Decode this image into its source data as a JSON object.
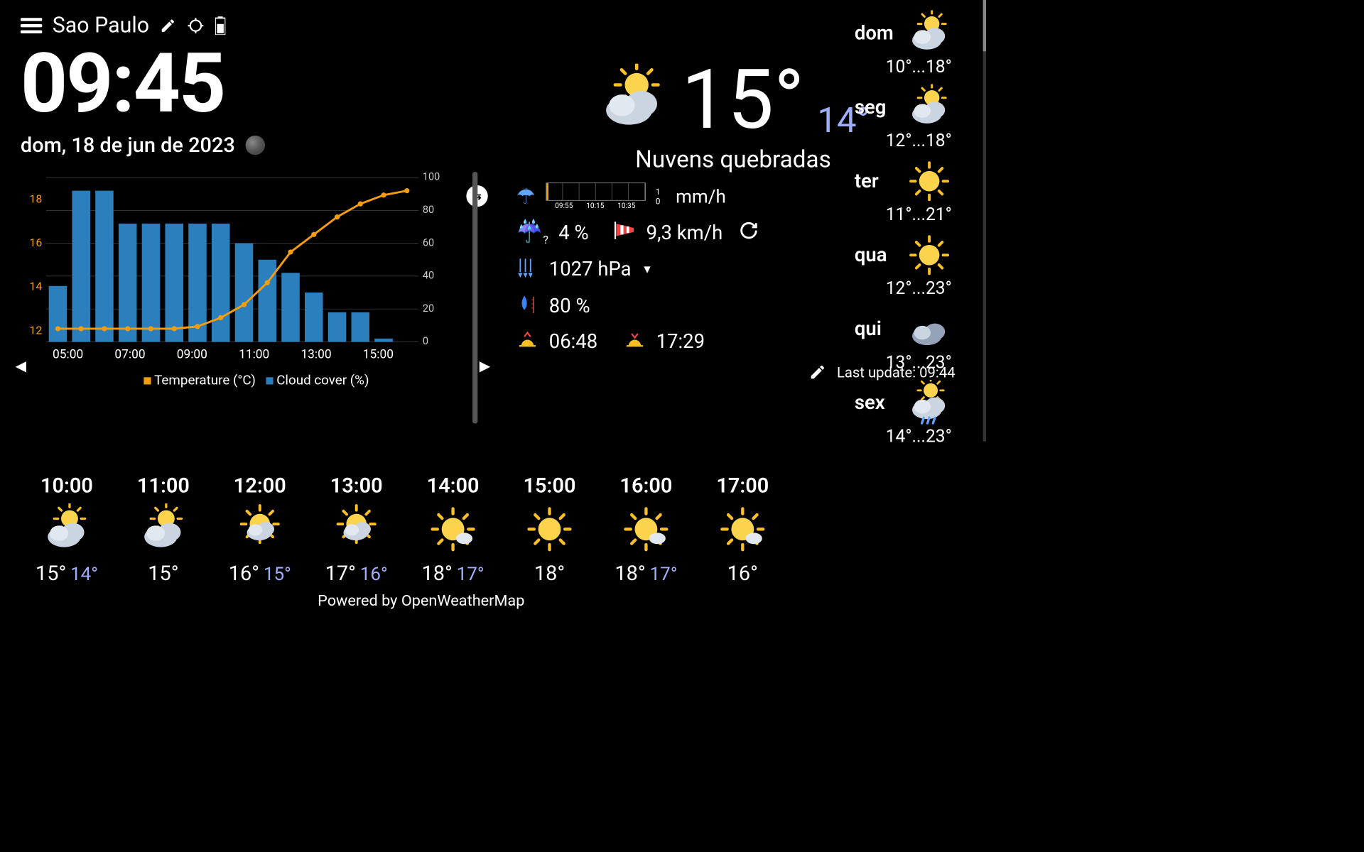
{
  "header": {
    "location": "Sao Paulo"
  },
  "clock": {
    "time": "09:45",
    "date": "dom, 18 de jun de 2023"
  },
  "chart_data": {
    "type": "bar",
    "title": "",
    "series": [
      {
        "name": "Temperature (°C)",
        "color": "#f59e0b",
        "axis": "left",
        "type": "line",
        "values": [
          12.1,
          12.1,
          12.1,
          12.1,
          12.1,
          12.1,
          12.2,
          12.6,
          13.2,
          14.2,
          15.6,
          16.4,
          17.2,
          17.8,
          18.2,
          18.4
        ]
      },
      {
        "name": "Cloud cover (%)",
        "color": "#2b7fbd",
        "axis": "right",
        "type": "bar",
        "values": [
          34,
          92,
          92,
          72,
          72,
          72,
          72,
          72,
          60,
          50,
          42,
          30,
          18,
          18,
          2,
          0
        ]
      }
    ],
    "x_ticks": [
      "05:00",
      "07:00",
      "09:00",
      "11:00",
      "13:00",
      "15:00"
    ],
    "left_axis": {
      "label": "Temperature (°C)",
      "ticks": [
        12,
        14,
        16,
        18
      ]
    },
    "right_axis": {
      "label": "Cloud cover (%)",
      "ticks": [
        0,
        20,
        40,
        60,
        80,
        100
      ]
    }
  },
  "current": {
    "temp": "15°",
    "feels": "14°",
    "condition": "Nuvens quebradas",
    "precip_unit": "mm/h",
    "precip_times": [
      "09:55",
      "10:15",
      "10:35"
    ],
    "precip_scale_max": "1",
    "precip_scale_min": "0",
    "pop": "4 %",
    "wind": "9,3 km/h",
    "pressure": "1027 hPa",
    "humidity": "80 %",
    "sunrise": "06:48",
    "sunset": "17:29",
    "last_update_label": "Last update:",
    "last_update": "09:44"
  },
  "hourly": [
    {
      "time": "10:00",
      "icon": "partly-cloudy",
      "temp": "15°",
      "feels": "14°"
    },
    {
      "time": "11:00",
      "icon": "partly-cloudy",
      "temp": "15°",
      "feels": ""
    },
    {
      "time": "12:00",
      "icon": "sunny-cloudy",
      "temp": "16°",
      "feels": "15°"
    },
    {
      "time": "13:00",
      "icon": "sunny-cloudy",
      "temp": "17°",
      "feels": "16°"
    },
    {
      "time": "14:00",
      "icon": "sunny-light",
      "temp": "18°",
      "feels": "17°"
    },
    {
      "time": "15:00",
      "icon": "sunny",
      "temp": "18°",
      "feels": ""
    },
    {
      "time": "16:00",
      "icon": "sunny-light",
      "temp": "18°",
      "feels": "17°"
    },
    {
      "time": "17:00",
      "icon": "sunny-light",
      "temp": "16°",
      "feels": ""
    }
  ],
  "daily": [
    {
      "day": "dom",
      "icon": "partly-cloudy",
      "lo": "10°",
      "hi": "18°"
    },
    {
      "day": "seg",
      "icon": "partly-cloudy",
      "lo": "12°",
      "hi": "18°"
    },
    {
      "day": "ter",
      "icon": "sunny",
      "lo": "11°",
      "hi": "21°"
    },
    {
      "day": "qua",
      "icon": "sunny",
      "lo": "12°",
      "hi": "23°"
    },
    {
      "day": "qui",
      "icon": "cloudy",
      "lo": "13°",
      "hi": "23°"
    },
    {
      "day": "sex",
      "icon": "rainy",
      "lo": "14°",
      "hi": "23°"
    }
  ],
  "attribution": "Powered by OpenWeatherMap"
}
